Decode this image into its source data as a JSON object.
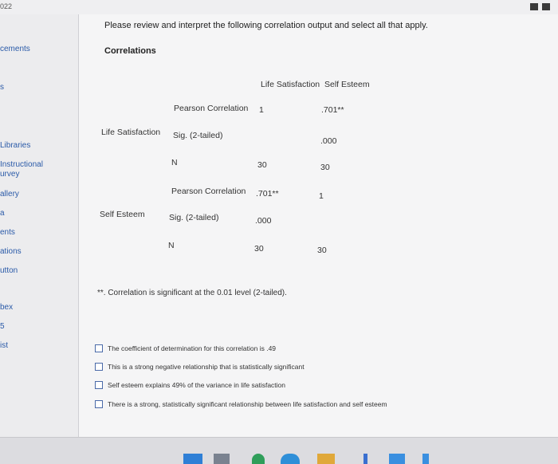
{
  "topbar": {
    "year": "022"
  },
  "sidebar": {
    "items": [
      "cements",
      "s",
      "Libraries",
      "Instructional",
      "urvey",
      "allery",
      "a",
      "ents",
      "ations",
      "utton",
      "bex",
      "5",
      "ist"
    ]
  },
  "question": {
    "prompt": "Please review and interpret the following correlation output and select all that apply.",
    "table_title": "Correlations",
    "col_headers": [
      "Life Satisfaction",
      "Self Esteem"
    ],
    "groups": [
      {
        "label": "Life Satisfaction",
        "rows": [
          {
            "stat": "Pearson Correlation",
            "values": [
              "1",
              ".701**"
            ]
          },
          {
            "stat": "Sig. (2-tailed)",
            "values": [
              "",
              ".000"
            ]
          },
          {
            "stat": "N",
            "values": [
              "30",
              "30"
            ]
          }
        ]
      },
      {
        "label": "Self Esteem",
        "rows": [
          {
            "stat": "Pearson Correlation",
            "values": [
              ".701**",
              "1"
            ]
          },
          {
            "stat": "Sig. (2-tailed)",
            "values": [
              ".000",
              ""
            ]
          },
          {
            "stat": "N",
            "values": [
              "30",
              "30"
            ]
          }
        ]
      }
    ],
    "footnote": "**. Correlation is significant at the 0.01 level (2-tailed).",
    "options": [
      "The coefficient of determination for this correlation is .49",
      "This is a strong negative relationship that is statistically significant",
      "Self esteem explains 49% of the variance in life satisfaction",
      "There is a strong, statistically significant relationship between life satisfaction and self esteem"
    ]
  },
  "colors": {
    "sidebar_link": "#2a5aa8",
    "checkbox_border": "#4a6aa8",
    "panel_bg": "#f5f5f6"
  }
}
